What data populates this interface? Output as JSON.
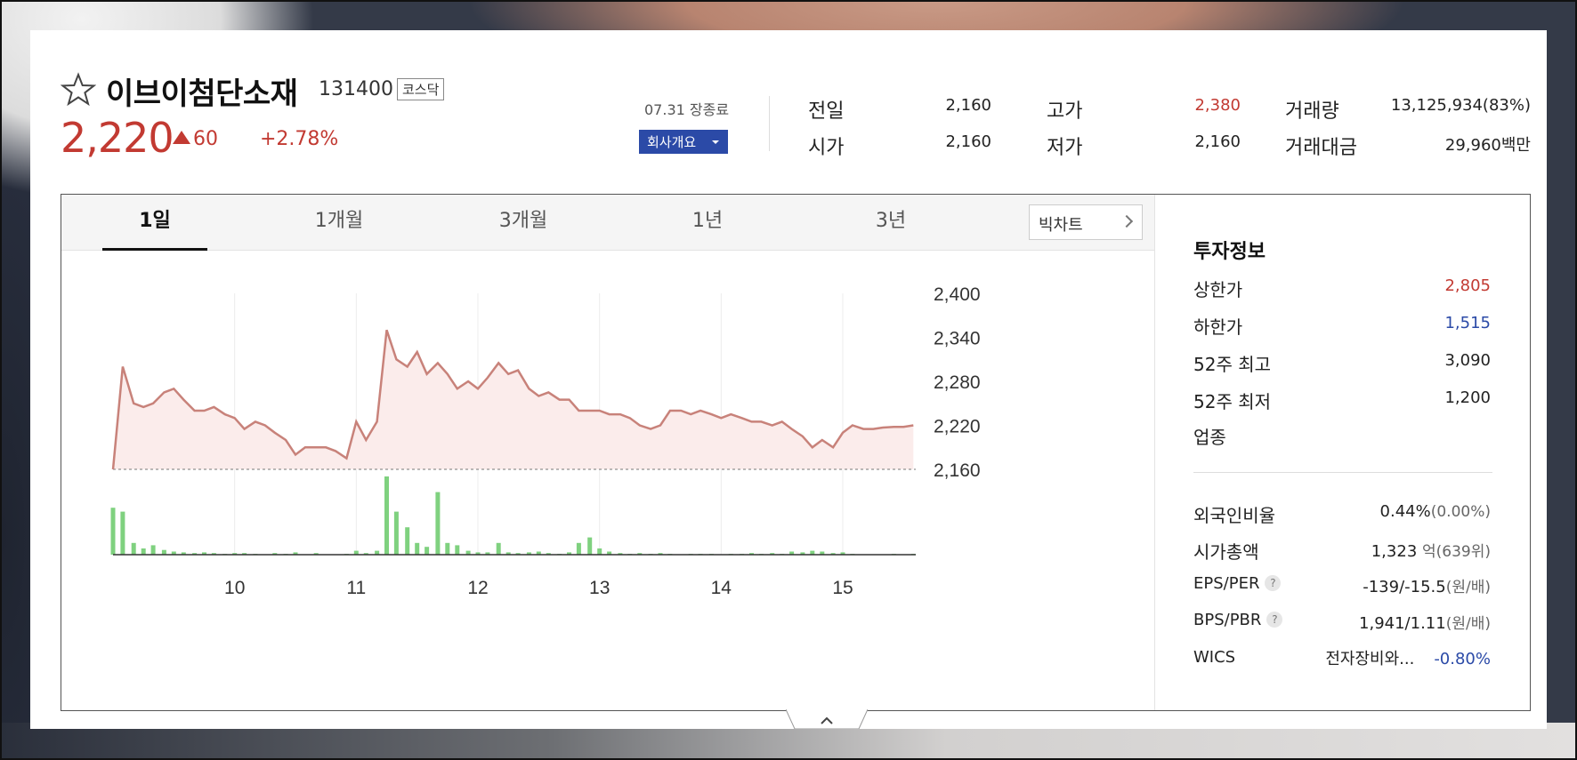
{
  "stock": {
    "name": "이브이첨단소재",
    "code": "131400",
    "market": "코스닥",
    "price": "2,220",
    "change": "60",
    "change_pct": "+2.78%",
    "session": "07.31 장종료",
    "company_button": "회사개요"
  },
  "stats": {
    "prev_label": "전일",
    "prev": "2,160",
    "open_label": "시가",
    "open": "2,160",
    "high_label": "고가",
    "high": "2,380",
    "low_label": "저가",
    "low": "2,160",
    "volume_label": "거래량",
    "volume": "13,125,934(83%)",
    "amount_label": "거래대금",
    "amount": "29,960백만"
  },
  "tabs": [
    "1일",
    "1개월",
    "3개월",
    "1년",
    "3년"
  ],
  "active_tab": "1일",
  "big_chart_label": "빅차트",
  "invest": {
    "title": "투자정보",
    "upper_label": "상한가",
    "upper": "2,805",
    "lower_label": "하한가",
    "lower": "1,515",
    "high52_label": "52주 최고",
    "high52": "3,090",
    "low52_label": "52주 최저",
    "low52": "1,200",
    "sector_label": "업종",
    "foreign_label": "외국인비율",
    "foreign": "0.44%",
    "foreign_sub": "(0.00%)",
    "mcap_label": "시가총액",
    "mcap": "1,323",
    "mcap_unit": "억",
    "mcap_rank": "(639위)",
    "eps_label": "EPS/PER",
    "eps": "-139/-15.5",
    "eps_unit": "(원/배)",
    "bps_label": "BPS/PBR",
    "bps": "1,941/1.11",
    "bps_unit": "(원/배)",
    "wics_label": "WICS",
    "wics_sector": "전자장비와...",
    "wics_pct": "-0.80%",
    "help_glyph": "?"
  },
  "colors": {
    "up": "#c23a32",
    "down": "#2b4aa7",
    "line": "#c8827a",
    "fill": "#fbeceb",
    "volume": "#7fd17f"
  },
  "chart_data": {
    "type": "line",
    "x_ticks": [
      "10",
      "11",
      "12",
      "13",
      "14",
      "15"
    ],
    "y_ticks": [
      "2,400",
      "2,340",
      "2,280",
      "2,220",
      "2,160"
    ],
    "ylim": [
      2160,
      2400
    ],
    "xlim": [
      9.0,
      15.6
    ],
    "baseline": 2160,
    "x": [
      9.0,
      9.08,
      9.17,
      9.25,
      9.33,
      9.42,
      9.5,
      9.58,
      9.67,
      9.75,
      9.83,
      9.92,
      10.0,
      10.08,
      10.17,
      10.25,
      10.33,
      10.42,
      10.5,
      10.58,
      10.67,
      10.75,
      10.83,
      10.92,
      11.0,
      11.08,
      11.17,
      11.25,
      11.33,
      11.42,
      11.5,
      11.58,
      11.67,
      11.75,
      11.83,
      11.92,
      12.0,
      12.08,
      12.17,
      12.25,
      12.33,
      12.42,
      12.5,
      12.58,
      12.67,
      12.75,
      12.83,
      12.92,
      13.0,
      13.08,
      13.17,
      13.25,
      13.33,
      13.42,
      13.5,
      13.58,
      13.67,
      13.75,
      13.83,
      13.92,
      14.0,
      14.08,
      14.17,
      14.25,
      14.33,
      14.42,
      14.5,
      14.58,
      14.67,
      14.75,
      14.83,
      14.92,
      15.0,
      15.08,
      15.17,
      15.25,
      15.33,
      15.42,
      15.5,
      15.58
    ],
    "y": [
      2160,
      2300,
      2250,
      2245,
      2250,
      2265,
      2270,
      2255,
      2240,
      2240,
      2245,
      2235,
      2230,
      2215,
      2225,
      2220,
      2210,
      2200,
      2180,
      2190,
      2190,
      2190,
      2185,
      2175,
      2225,
      2200,
      2225,
      2350,
      2310,
      2300,
      2320,
      2290,
      2305,
      2290,
      2270,
      2280,
      2270,
      2285,
      2305,
      2290,
      2295,
      2270,
      2260,
      2265,
      2255,
      2255,
      2240,
      2240,
      2240,
      2235,
      2235,
      2230,
      2220,
      2215,
      2220,
      2240,
      2240,
      2235,
      2240,
      2235,
      2230,
      2235,
      2230,
      2225,
      2225,
      2220,
      2225,
      2215,
      2205,
      2190,
      2200,
      2190,
      2210,
      2220,
      2215,
      2215,
      2217,
      2218,
      2218,
      2220
    ],
    "volume": [
      0.6,
      0.55,
      0.15,
      0.08,
      0.12,
      0.06,
      0.04,
      0.03,
      0.02,
      0.03,
      0.02,
      0.01,
      0.02,
      0.02,
      0.01,
      0.0,
      0.02,
      0.01,
      0.03,
      0.0,
      0.02,
      0.0,
      0.0,
      0.01,
      0.05,
      0.02,
      0.05,
      1.0,
      0.55,
      0.35,
      0.15,
      0.1,
      0.8,
      0.15,
      0.12,
      0.05,
      0.03,
      0.03,
      0.15,
      0.03,
      0.02,
      0.03,
      0.04,
      0.02,
      0.01,
      0.03,
      0.15,
      0.22,
      0.08,
      0.04,
      0.02,
      0.01,
      0.02,
      0.01,
      0.02,
      0.01,
      0.0,
      0.01,
      0.01,
      0.01,
      0.0,
      0.01,
      0.01,
      0.02,
      0.01,
      0.02,
      0.01,
      0.04,
      0.03,
      0.05,
      0.04,
      0.02,
      0.03,
      0.01,
      0.0,
      0.0,
      0.0,
      0.01,
      0.0,
      0.01
    ]
  }
}
